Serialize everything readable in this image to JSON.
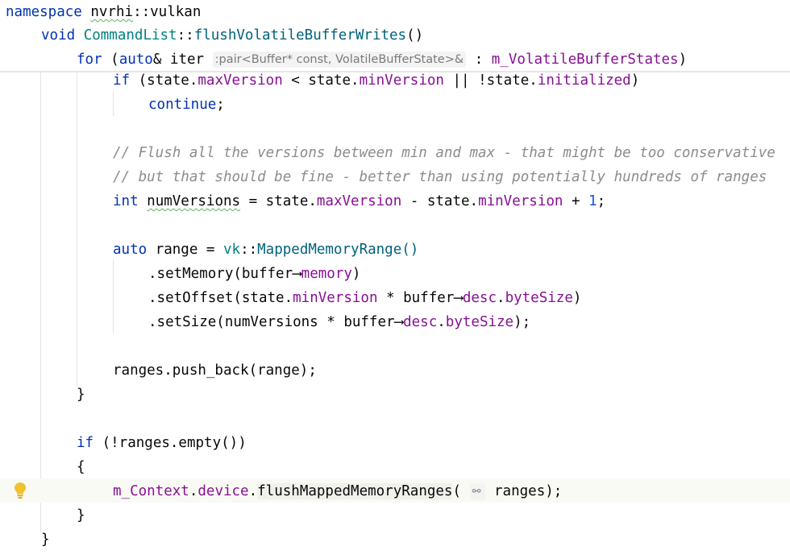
{
  "code": {
    "namespace_kw": "namespace",
    "namespace_name": "nvrhi",
    "scope_op": "::",
    "namespace_sub": "vulkan",
    "void_kw": "void",
    "class_name": "CommandList",
    "method_name": "flushVolatileBufferWrites",
    "method_parens": "()",
    "for_kw": "for",
    "for_open": " (",
    "auto_kw": "auto",
    "auto_ref": "& iter ",
    "type_hint": ":pair<Buffer* const, VolatileBufferState>&",
    "for_colon": " : ",
    "for_collection": "m_VolatileBufferStates",
    "for_close": ")",
    "if1_kw": "if",
    "if1_a": " (state.",
    "if1_field1": "maxVersion",
    "if1_b": " < state.",
    "if1_field2": "minVersion",
    "if1_c": " || !state.",
    "if1_field3": "initialized",
    "if1_d": ")",
    "continue_kw": "continue",
    "semicolon": ";",
    "comment1": "// Flush all the versions between min and max - that might be too conservative",
    "comment2": "// but that should be fine - better than using potentially hundreds of ranges",
    "int_kw": "int",
    "numver_var": "numVersions",
    "numver_a": " = state.",
    "numver_field1": "maxVersion",
    "numver_b": " - state.",
    "numver_field2": "minVersion",
    "numver_c": " + ",
    "numver_num": "1",
    "numver_d": ";",
    "auto2_kw": "auto",
    "range_a": " range = ",
    "range_ns": "vk",
    "range_op": "::",
    "range_ctor": "MappedMemoryRange()",
    "setmem_a": ".setMemory(buffer",
    "arrow": "⟶",
    "setmem_field": "memory",
    "setmem_b": ")",
    "setoff_a": ".setOffset(state.",
    "setoff_field": "minVersion",
    "setoff_b": " * buffer",
    "setoff_field2": "desc",
    "setoff_dot": ".",
    "setoff_field3": "byteSize",
    "setoff_c": ")",
    "setsize_a": ".setSize(numVersions * buffer",
    "setsize_field": "desc",
    "setsize_dot": ".",
    "setsize_field2": "byteSize",
    "setsize_b": ");",
    "push_line": "ranges.push_back(range);",
    "close_brace": "}",
    "if2_kw": "if",
    "if2_rest": " (!ranges.empty())",
    "open_brace": "{",
    "flush_ctx": "m_Context",
    "flush_dot1": ".",
    "flush_device": "device",
    "flush_dot2": ".",
    "flush_fn": "flushMappedMemoryRanges",
    "flush_open": "(",
    "param_hint_icon": "⚯",
    "flush_arg": "ranges);"
  },
  "colors": {
    "keyword": "#0033b3",
    "class": "#008080",
    "method": "#00627a",
    "field": "#871094",
    "number": "#1750eb",
    "comment": "#8c8c8c",
    "text": "#080808",
    "bulb": "#f2c12e"
  },
  "icons": {
    "gutter": "lightbulb-icon",
    "param_hint": "link-icon"
  }
}
